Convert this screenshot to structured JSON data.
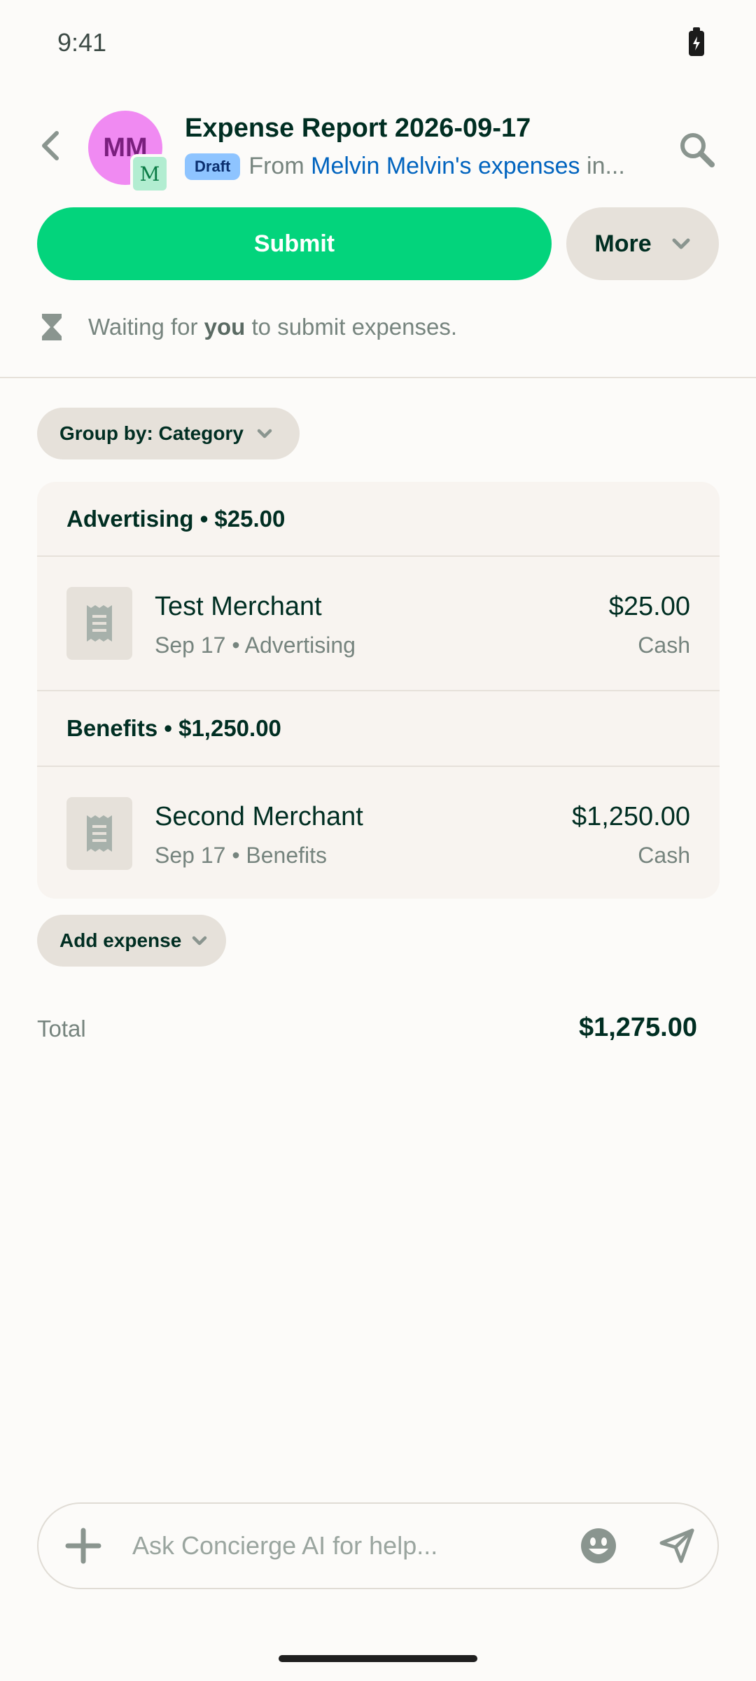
{
  "status_bar": {
    "time": "9:41",
    "battery_icon": "battery-charging-icon"
  },
  "header": {
    "back_icon": "chevron-left-icon",
    "avatar_initials": "MM",
    "workspace_avatar": "M",
    "title": "Expense Report 2026-09-17",
    "badge": "Draft",
    "from_prefix": "From",
    "from_link": "Melvin Melvin's expenses",
    "from_suffix": "in...",
    "search_icon": "search-icon"
  },
  "actions": {
    "submit_label": "Submit",
    "more_label": "More"
  },
  "status_message": {
    "prefix": "Waiting for",
    "emphasis": "you",
    "suffix": "to submit expenses."
  },
  "group_by_label": "Group by: Category",
  "groups": [
    {
      "header": "Advertising • $25.00",
      "expense": {
        "merchant": "Test Merchant",
        "meta": "Sep 17 • Advertising",
        "amount": "$25.00",
        "method": "Cash"
      }
    },
    {
      "header": "Benefits • $1,250.00",
      "expense": {
        "merchant": "Second Merchant",
        "meta": "Sep 17 • Benefits",
        "amount": "$1,250.00",
        "method": "Cash"
      }
    }
  ],
  "add_expense_label": "Add expense",
  "total": {
    "label": "Total",
    "value": "$1,275.00"
  },
  "composer": {
    "placeholder": "Ask Concierge AI for help..."
  },
  "colors": {
    "accent": "#03D47C",
    "link": "#0164BF",
    "text": "#002E22",
    "muted": "#76847E",
    "badge": "#8EC4FF",
    "avatar": "#F08AF2"
  }
}
